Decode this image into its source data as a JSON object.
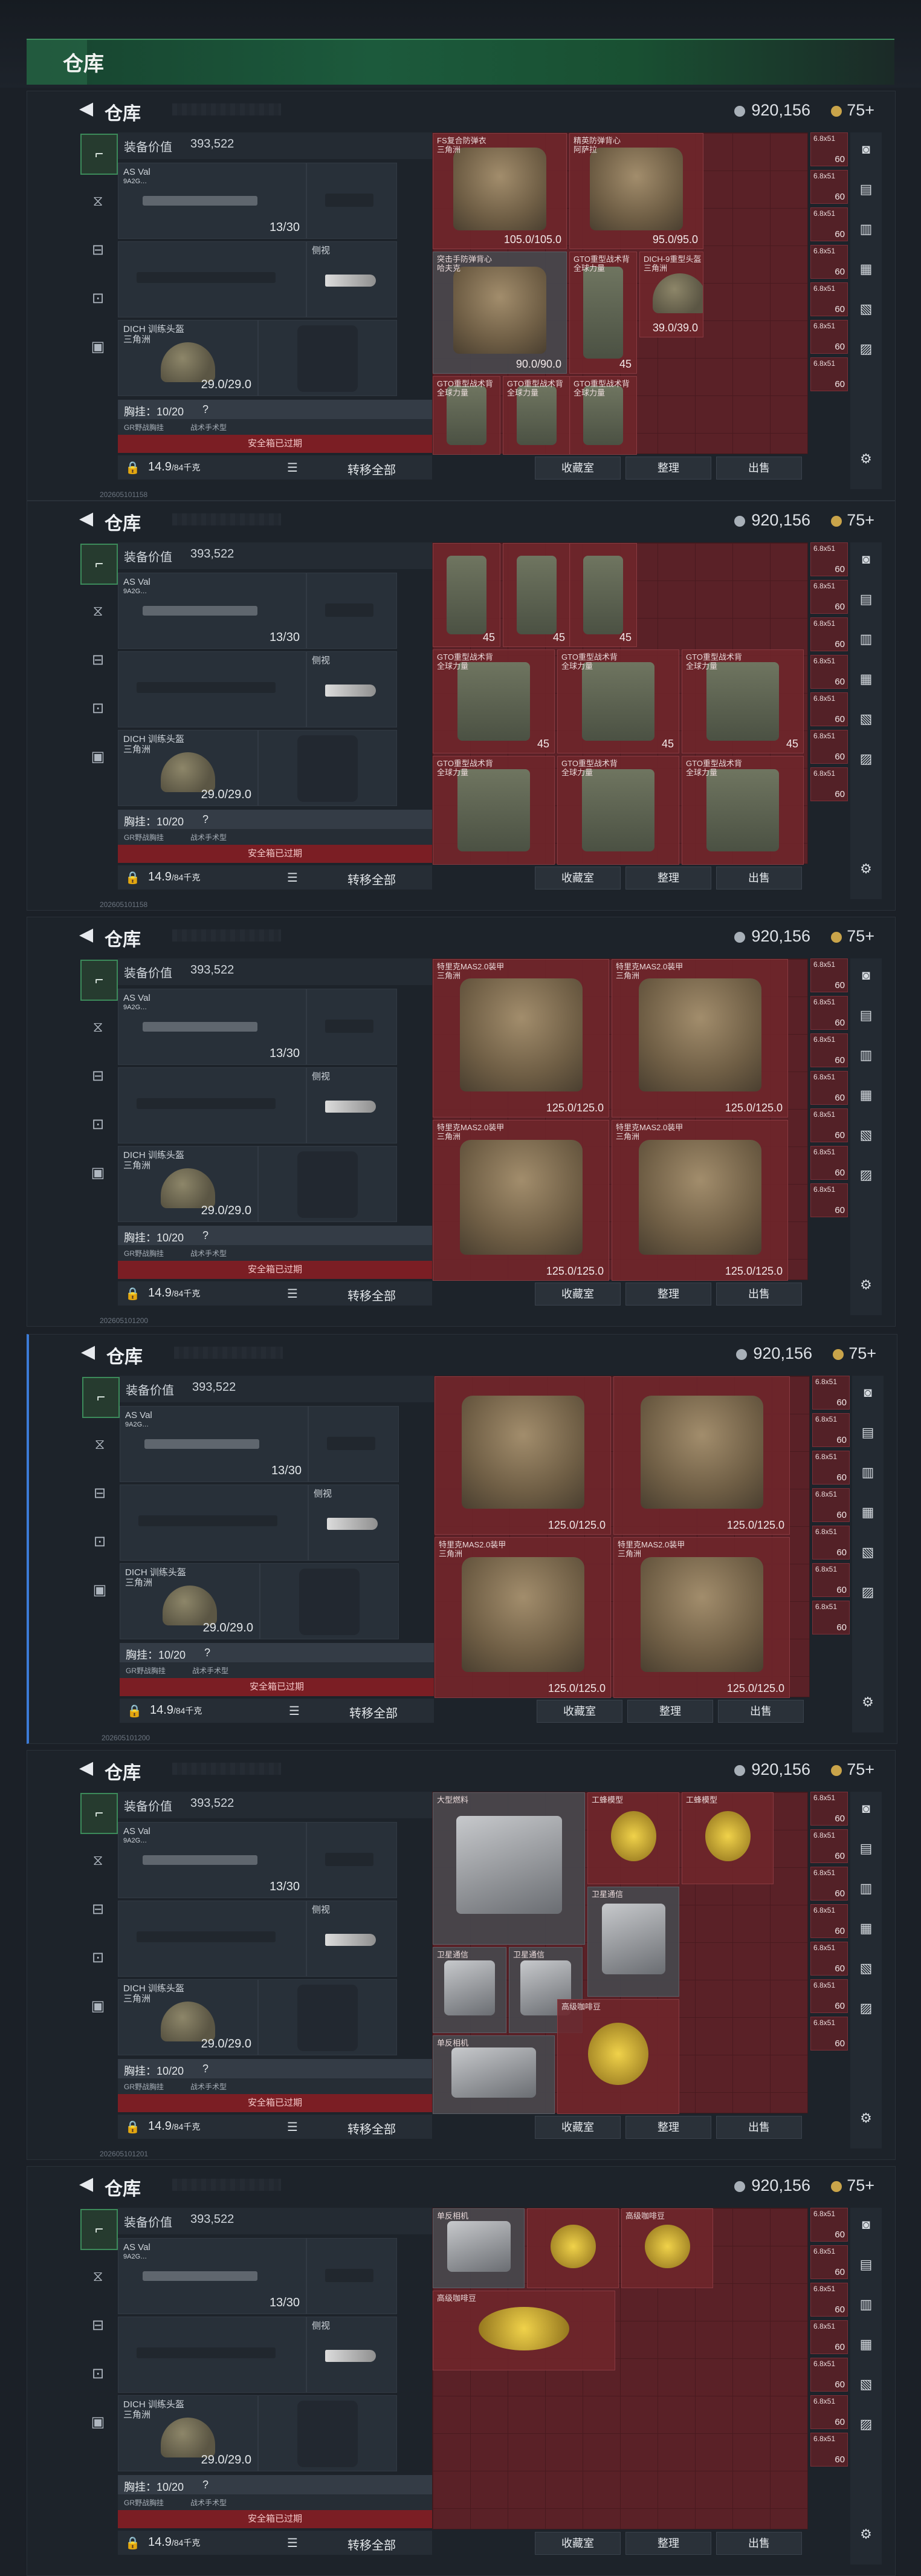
{
  "app": {
    "title": "仓库"
  },
  "header": {
    "title": "仓库",
    "money": "920,156",
    "level": "75+"
  },
  "gear": {
    "value_label": "装备价值",
    "value": "393,522",
    "weapon_name": "AS Val",
    "weapon_sub": "9A2G…",
    "ammo_count": "13/30",
    "side_label": "侧视",
    "helmet_name": "DICH 训练头盔\n三角洲",
    "helmet_dura": "29.0/29.0",
    "chest_label": "胸挂：10/20",
    "chest_q": "?",
    "tag_left": "GR野战胸挂",
    "tag_right": "战术手术型",
    "warning": "安全箱已过期",
    "weight": "14.9",
    "weight_unit": "/84千克",
    "transfer_all": "转移全部"
  },
  "stash_actions": {
    "store": "收藏室",
    "sort": "整理",
    "sell": "出售"
  },
  "panels": [
    {
      "items": [
        {
          "label": "FS复合防弹衣\n三角洲",
          "dura": "105.0/105.0",
          "type": "armor"
        },
        {
          "label": "精英防弹背心\n阿萨拉",
          "dura": "95.0/95.0",
          "type": "armor-dark"
        },
        {
          "label": "突击手防弹背心\n哈夫克",
          "dura": "90.0/90.0",
          "type": "armor-gray"
        },
        {
          "label": "GTO重型战术背\n全球力量",
          "dura": "45",
          "type": "rig"
        },
        {
          "label": "DICH-9重型头盔\n三角洲",
          "dura": "39.0/39.0",
          "type": "helmet"
        },
        {
          "label": "GTO重型战术背\n全球力量",
          "dura": "",
          "type": "rig"
        },
        {
          "label": "GTO重型战术背\n全球力量",
          "dura": "",
          "type": "rig"
        },
        {
          "label": "GTO重型战术背\n全球力量",
          "dura": "",
          "type": "rig"
        }
      ]
    },
    {
      "items": [
        {
          "label": "",
          "dura": "45",
          "type": "rig"
        },
        {
          "label": "",
          "dura": "45",
          "type": "rig"
        },
        {
          "label": "",
          "dura": "45",
          "type": "rig"
        },
        {
          "label": "GTO重型战术背\n全球力量",
          "dura": "45",
          "type": "rig"
        },
        {
          "label": "GTO重型战术背\n全球力量",
          "dura": "45",
          "type": "rig"
        },
        {
          "label": "GTO重型战术背\n全球力量",
          "dura": "45",
          "type": "rig"
        },
        {
          "label": "GTO重型战术背\n全球力量",
          "dura": "",
          "type": "rig"
        },
        {
          "label": "GTO重型战术背\n全球力量",
          "dura": "",
          "type": "rig"
        },
        {
          "label": "GTO重型战术背\n全球力量",
          "dura": "",
          "type": "rig"
        }
      ]
    },
    {
      "items": [
        {
          "label": "特里克MAS2.0装甲\n三角洲",
          "dura": "125.0/125.0",
          "type": "armor"
        },
        {
          "label": "特里克MAS2.0装甲\n三角洲",
          "dura": "125.0/125.0",
          "type": "armor"
        },
        {
          "label": "特里克MAS2.0装甲\n三角洲",
          "dura": "125.0/125.0",
          "type": "armor"
        },
        {
          "label": "特里克MAS2.0装甲\n三角洲",
          "dura": "125.0/125.0",
          "type": "armor"
        }
      ]
    },
    {
      "items": [
        {
          "label": "",
          "dura": "125.0/125.0",
          "type": "armor"
        },
        {
          "label": "",
          "dura": "125.0/125.0",
          "type": "armor"
        },
        {
          "label": "特里克MAS2.0装甲\n三角洲",
          "dura": "125.0/125.0",
          "type": "armor"
        },
        {
          "label": "特里克MAS2.0装甲\n三角洲",
          "dura": "125.0/125.0",
          "type": "armor"
        }
      ]
    },
    {
      "items": [
        {
          "label": "大型燃料",
          "dura": "",
          "type": "box"
        },
        {
          "label": "工蜂模型",
          "dura": "",
          "type": "gold"
        },
        {
          "label": "工蜂模型",
          "dura": "",
          "type": "gold"
        },
        {
          "label": "卫星通信",
          "dura": "",
          "type": "box"
        },
        {
          "label": "卫星通信",
          "dura": "",
          "type": "box"
        },
        {
          "label": "卫星通信",
          "dura": "",
          "type": "box"
        },
        {
          "label": "单反相机",
          "dura": "",
          "type": "box"
        },
        {
          "label": "高级咖啡豆",
          "dura": "",
          "type": "gold"
        }
      ]
    },
    {
      "items": [
        {
          "label": "单反相机",
          "dura": "",
          "type": "box"
        },
        {
          "label": "",
          "dura": "",
          "type": "gold"
        },
        {
          "label": "高级咖啡豆",
          "dura": "",
          "type": "gold"
        },
        {
          "label": "高级咖啡豆",
          "dura": "",
          "type": "gold"
        }
      ]
    }
  ],
  "ammo": {
    "label": "6.8x51",
    "count": "60"
  },
  "ids": [
    "202605101158",
    "202605101158",
    "202605101200",
    "202605101200",
    "202605101201",
    ""
  ]
}
